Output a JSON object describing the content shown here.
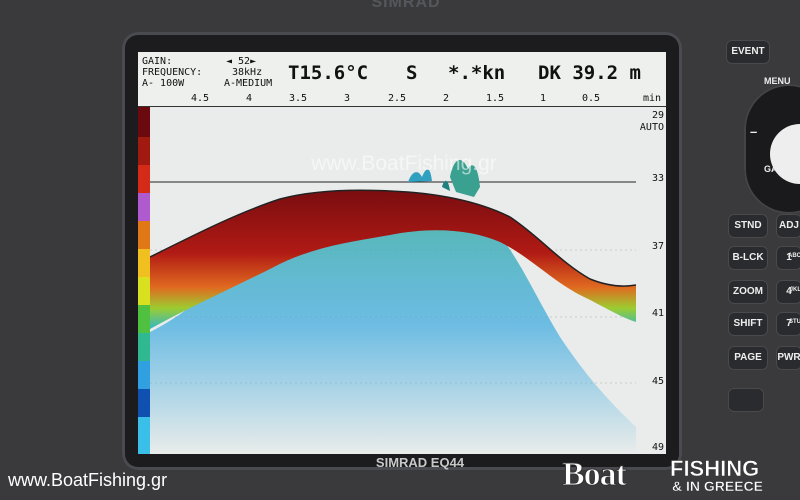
{
  "device": {
    "brand": "SIMRAD",
    "model": "SIMRAD EQ44"
  },
  "header": {
    "gain_label": "GAIN:",
    "gain_value": "◄ 52►",
    "frequency_label": "FREQUENCY:",
    "frequency_value": "38kHz",
    "mode_left": "A- 100W",
    "mode_right": "A-MEDIUM",
    "temperature": "T15.6°C",
    "status_letter": "S",
    "speed": "*.*kn",
    "depth_readout": "DK 39.2 m"
  },
  "scale": {
    "labels": [
      "4.5",
      "4",
      "3.5",
      "3",
      "2.5",
      "2",
      "1.5",
      "1",
      "0.5"
    ],
    "unit": "min"
  },
  "depth_scale": {
    "labels": [
      "29",
      "AUTO",
      "33",
      "37",
      "41",
      "45",
      "49"
    ]
  },
  "colorbar": [
    "#6a0a0e",
    "#a01a10",
    "#d42a18",
    "#b05ad0",
    "#e07818",
    "#f0c020",
    "#d8e020",
    "#50c040",
    "#30b890",
    "#30a0e0",
    "#1050b0",
    "#3ac0e8"
  ],
  "keys": {
    "event": "EVENT",
    "menu": "MENU",
    "minus": "–",
    "gain": "GAIN",
    "stnd": "STND",
    "adj": "ADJ",
    "blck": "B-LCK",
    "one": "1",
    "one_sup": "ABC",
    "zoom": "ZOOM",
    "four": "4",
    "four_sup": "JKL",
    "shift": "SHIFT",
    "seven": "7",
    "seven_sup": "STU",
    "page": "PAGE",
    "pwr": "PWR"
  },
  "watermarks": {
    "center": "www.BoatFishing.gr",
    "bottom_left": "www.BoatFishing.gr",
    "logo_boat": "Boat",
    "logo_fishing": "FISHING",
    "logo_greece": "& IN GREECE"
  }
}
